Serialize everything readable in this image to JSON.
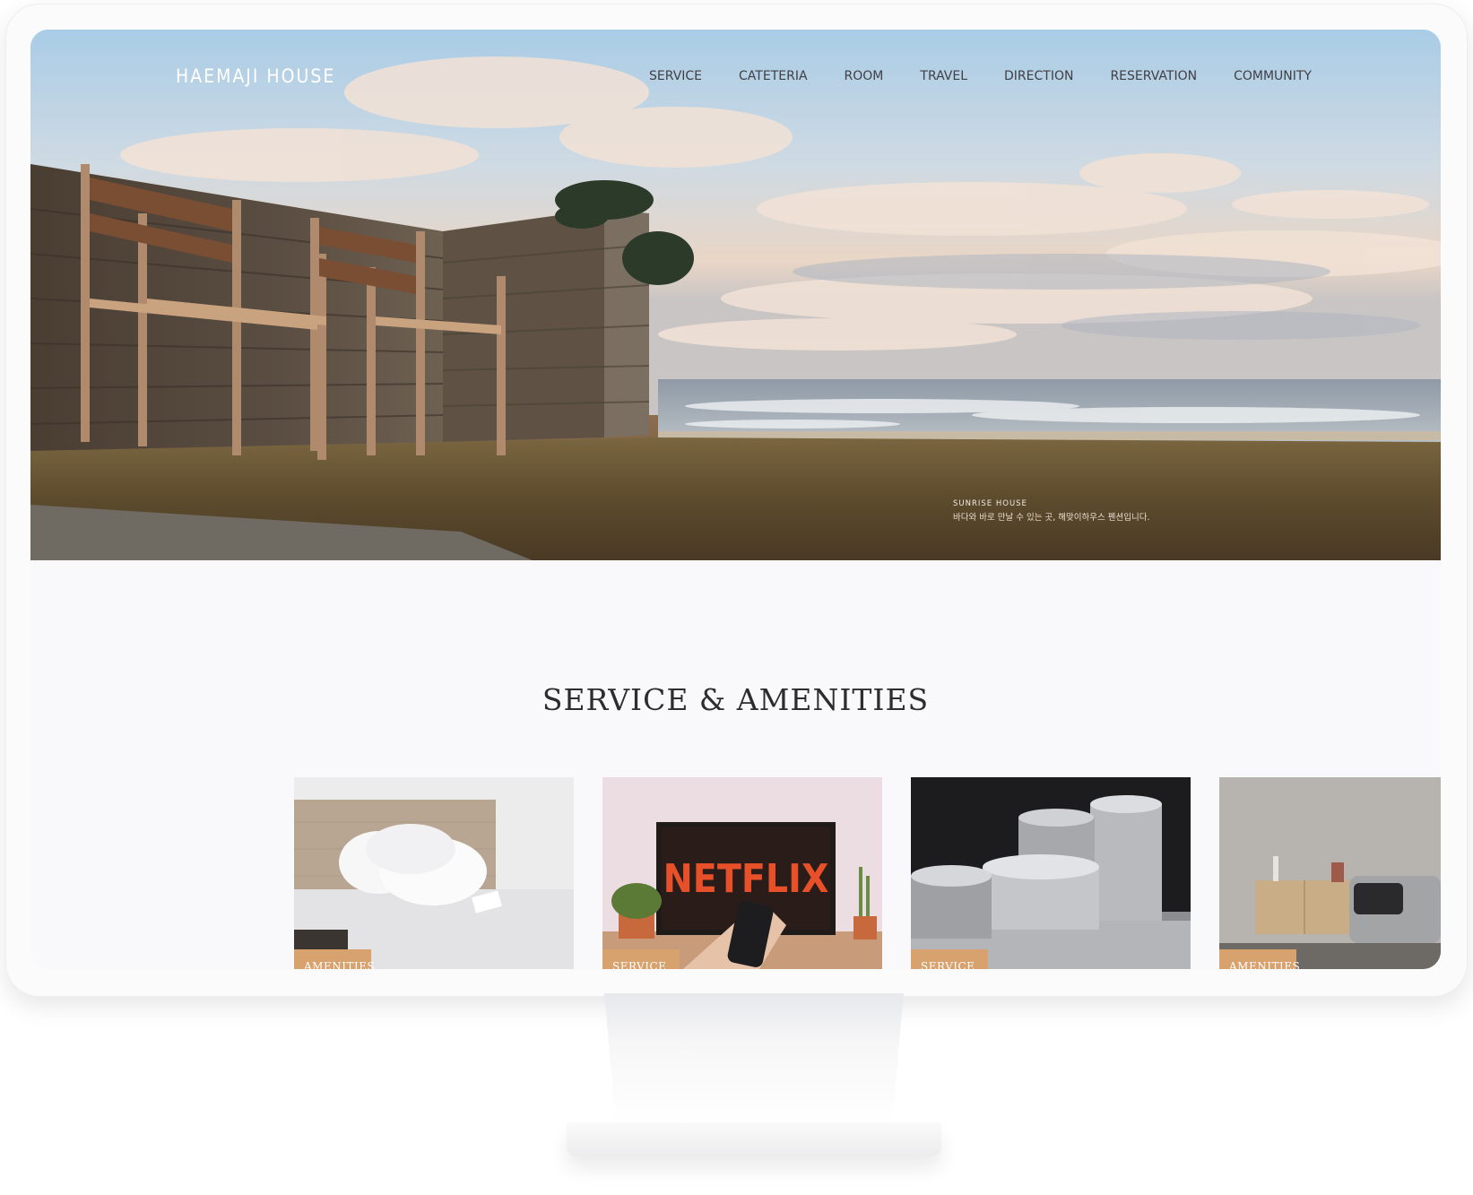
{
  "site": {
    "logo": "HAEMAJI HOUSE",
    "nav": [
      "SERVICE",
      "CATETERIA",
      "ROOM",
      "TRAVEL",
      "DIRECTION",
      "RESERVATION",
      "COMMUNITY"
    ]
  },
  "hero": {
    "caption_title": "SUNRISE HOUSE",
    "caption_text": "바다와 바로 만날 수 있는 곳, 해맞이하우스 펜션입니다."
  },
  "services": {
    "title": "SERVICE & AMENITIES",
    "cards": [
      {
        "tag": "AMENITIES",
        "image": "bed-image"
      },
      {
        "tag": "SERVICE",
        "image": "netflix-tv-image",
        "screen_text": "NETFLIX"
      },
      {
        "tag": "SERVICE",
        "image": "cookware-image"
      },
      {
        "tag": "AMENITIES",
        "image": "living-room-image"
      }
    ]
  },
  "colors": {
    "tag_background": "#d8a26f",
    "netflix_red": "#e8502a",
    "page_background": "#f9f9fb"
  }
}
